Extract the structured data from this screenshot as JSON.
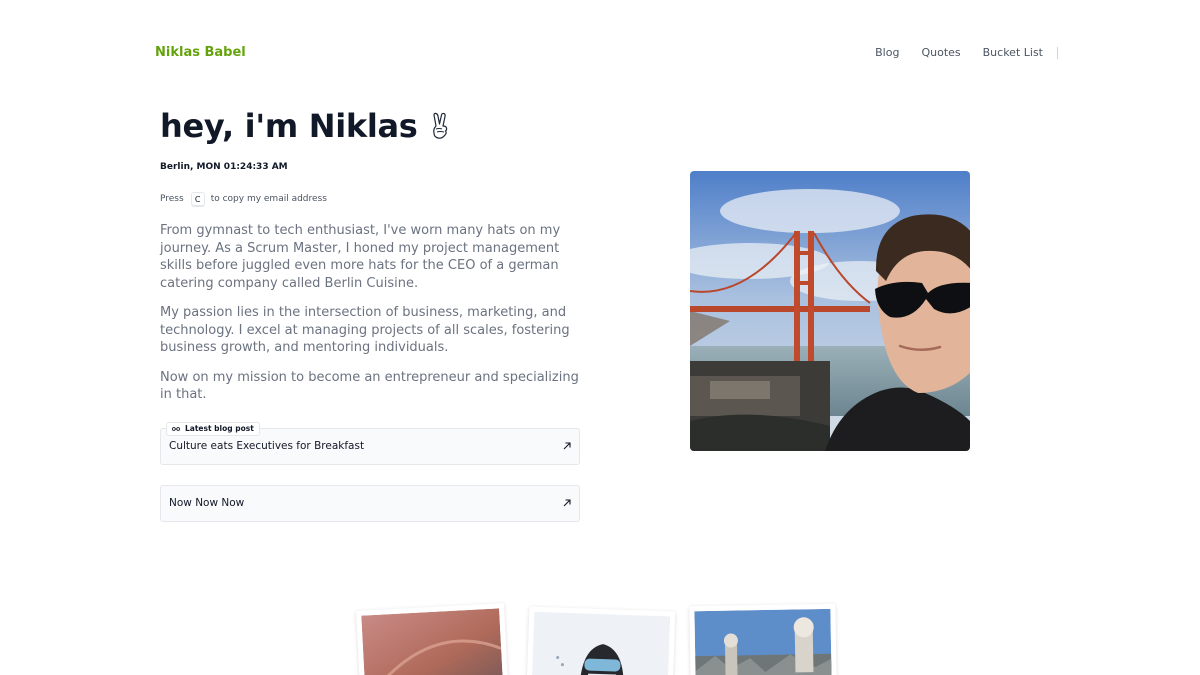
{
  "header": {
    "brand": "Niklas Babel",
    "nav": [
      {
        "label": "Blog"
      },
      {
        "label": "Quotes"
      },
      {
        "label": "Bucket List"
      }
    ]
  },
  "hero": {
    "title": "hey, i'm Niklas",
    "emoji_icon": "victory-hand-icon",
    "clock": "Berlin, MON 01:24:33 AM",
    "copy_hint": {
      "prefix": "Press",
      "key": "C",
      "suffix": "to copy my email address"
    },
    "bio": [
      "From gymnast to tech enthusiast, I've worn many hats on my journey. As a Scrum Master, I honed my project management skills before juggled even more hats for the CEO of a german catering company called Berlin Cuisine.",
      "My passion lies in the intersection of business, marketing, and technology. I excel at managing projects of all scales, fostering business growth, and mentoring individuals.",
      "Now on my mission to become an entrepreneur and specializing in that."
    ]
  },
  "cards": {
    "blog": {
      "badge": "Latest blog post",
      "badge_icon": "glasses-icon",
      "title": "Culture eats Executives for Breakfast",
      "icon": "arrow-up-right-icon"
    },
    "now": {
      "title": "Now Now Now",
      "icon": "arrow-up-right-icon"
    }
  },
  "colors": {
    "brand": "#65a30d",
    "text": "#111827",
    "muted": "#6b7280",
    "border": "#e5e7eb"
  }
}
